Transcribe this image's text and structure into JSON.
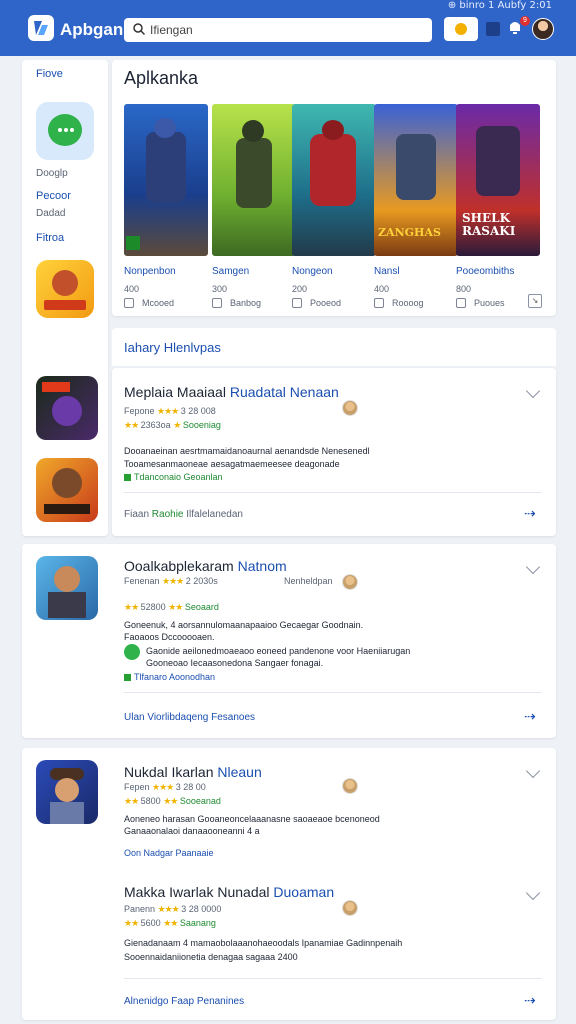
{
  "status_bar": {
    "text": "⊕ binro  1 Aubfy  2:01"
  },
  "header": {
    "app_name": "Apbgan",
    "search": {
      "value": "Ifiengan",
      "placeholder": ""
    },
    "notification_count": "9",
    "brand_color": "#2f64c8"
  },
  "sidebar": {
    "link_1": "Fiove",
    "app_icon_1_name": "chat-bubble-icon",
    "text_1": "Dooglp",
    "link_2": "Pecoor",
    "text_2": "Dadad",
    "link_3": "Fitroa"
  },
  "featured": {
    "title": "Aplkanka",
    "games": [
      {
        "name": "Nonpenbon",
        "count": "400",
        "meta": "Mcooed",
        "badge": "",
        "caption": ""
      },
      {
        "name": "Samgen",
        "count": "300",
        "meta": "Banbog",
        "badge": "",
        "caption": ""
      },
      {
        "name": "Nongeon",
        "count": "200",
        "meta": "Pooeod",
        "badge": "",
        "caption": ""
      },
      {
        "name": "Nansl",
        "count": "400",
        "meta": "Roooog",
        "badge": "",
        "caption": "ZANGHAS"
      },
      {
        "name": "Pooeombiths",
        "count": "800",
        "meta": "Puoues",
        "badge": "",
        "caption": "SHELK RASAKI"
      }
    ]
  },
  "section": {
    "title": "Iahary Hlenlvpas"
  },
  "reviews": [
    {
      "title": "Meplaia Maaiaal",
      "title_accent": "Ruadatal Nenaan",
      "rating_line": "Fepone",
      "rating_value": "3 28 008",
      "sub_line": "2363oa",
      "sub_label": "Sooeniag",
      "text_1": "Dooanaeinan aesrtmamaidanoaurnal aenandsde  Nenesenedl",
      "text_2": "Tooamesanmaoneae aesagatmaemeesee deagonade",
      "green_line": "Tdanconaio Geoanlan",
      "cta_prefix": "Fiaan",
      "cta_green": "Raohie",
      "cta_grey": "Ilfalelanedan"
    },
    {
      "title": "Ooalkabplekaram",
      "title_accent": "Natnom",
      "aside": "Nenheldpan",
      "rating_line": "Fenenan",
      "rating_value": "2 2030s",
      "sub_line": "52800",
      "sub_label": "Seoaard",
      "text_1": "Goneenuk, 4 aorsannulomaanapaaioo  Gecaegar Goodnain.",
      "text_2": "Faoaoos Dccooooaen.",
      "text_3": "Gaonide aeilonedmoaeaoo eoneed pandenone voor Haeniiarugan",
      "text_4": "Gooneoao Iecaasonedona Sangaer fonagai.",
      "green_line": "Tlfanaro Aoonodhan",
      "cta": "Ulan Viorlibdaqeng Fesanoes"
    },
    {
      "title": "Nukdal Ikarlan",
      "title_accent": "Nleaun",
      "rating_line": "Fepen",
      "rating_value": "3 28 00",
      "sub_line": "5800",
      "sub_label": "Sooeanad",
      "text_1": "Aoneneo harasan Gooaneoncelaaanasne saoaeaoe bcenoneod",
      "text_2": "Ganaaonalaoi danaaooneanni  4 a",
      "cta": "Oon Nadgar Paanaaie"
    },
    {
      "title": "Makka Iwarlak Nunadal",
      "title_accent": "Duoaman",
      "rating_line": "Panenn",
      "rating_value": "3 28 0000",
      "sub_line": "5600",
      "sub_label": "Saanang",
      "text_1": "Gienadanaam 4 mamaobolaaanohaeoodals Ipanamiae Gadinnpenaih",
      "text_2": "Sooennaidaniionetia denagaa sagaaa  2400",
      "cta": "Alnenidgo Faap Penanines"
    }
  ]
}
